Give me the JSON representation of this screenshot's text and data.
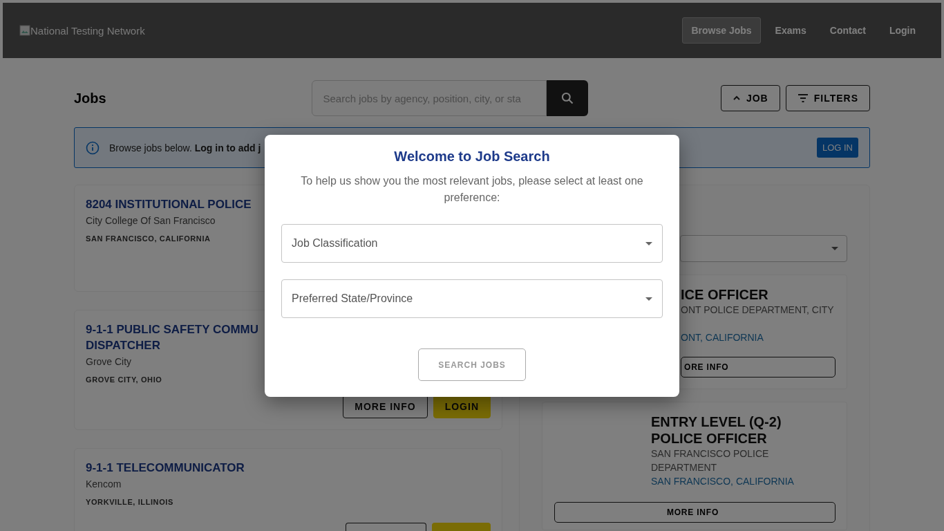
{
  "header": {
    "logo_alt": "National Testing Network",
    "nav": [
      {
        "label": "Browse Jobs",
        "selected": true
      },
      {
        "label": "Exams",
        "selected": false
      },
      {
        "label": "Contact",
        "selected": false
      },
      {
        "label": "Login",
        "selected": false
      }
    ]
  },
  "toolbar": {
    "title": "Jobs",
    "search": {
      "placeholder": "Search jobs by agency, position, city, or sta"
    },
    "buttons": [
      {
        "label": "JOB",
        "kind": "caret"
      },
      {
        "label": "FILTERS",
        "kind": "filter"
      }
    ]
  },
  "banner": {
    "text": "Browse jobs below. **Log in to add j**",
    "button": "LOG IN"
  },
  "jobs": [
    {
      "title": "8204 INSTITUTIONAL POLICE",
      "agency": "City College Of San Francisco",
      "location": "SAN FRANCISCO, CALIFORNIA"
    },
    {
      "title": "9-1-1 PUBLIC SAFETY COMMU",
      "title_line_2": "DISPATCHER",
      "agency": "Grove City",
      "location": "GROVE CITY, OHIO",
      "actions": [
        {
          "label": "MORE INFO",
          "kind": "outline"
        },
        {
          "label": "LOGIN",
          "kind": "primary"
        }
      ]
    },
    {
      "title": "9-1-1 TELECOMMUNICATOR",
      "agency": "Kencom",
      "location": "YORKVILLE, ILLINOIS",
      "actions_cut": true
    }
  ],
  "featured": {
    "cards": [
      {
        "covered": true,
        "title": "ICE OFFICER",
        "agency": "ONT POLICE DEPARTMENT, CITY",
        "location": "ONT, CALIFORNIA",
        "button": "ORE INFO"
      },
      {
        "covered": false,
        "title": "ENTRY LEVEL (Q-2) POLICE OFFICER",
        "agency": "SAN FRANCISCO POLICE DEPARTMENT",
        "location": "SAN FRANCISCO, CALIFORNIA",
        "button": "MORE INFO"
      }
    ]
  },
  "modal": {
    "title": "Welcome to Job Search",
    "text": "To help us show you the most relevant jobs, please select at least one preference:",
    "fields": [
      {
        "label": "Job Classification"
      },
      {
        "label": "Preferred State/Province"
      }
    ],
    "button": "SEARCH JOBS"
  }
}
